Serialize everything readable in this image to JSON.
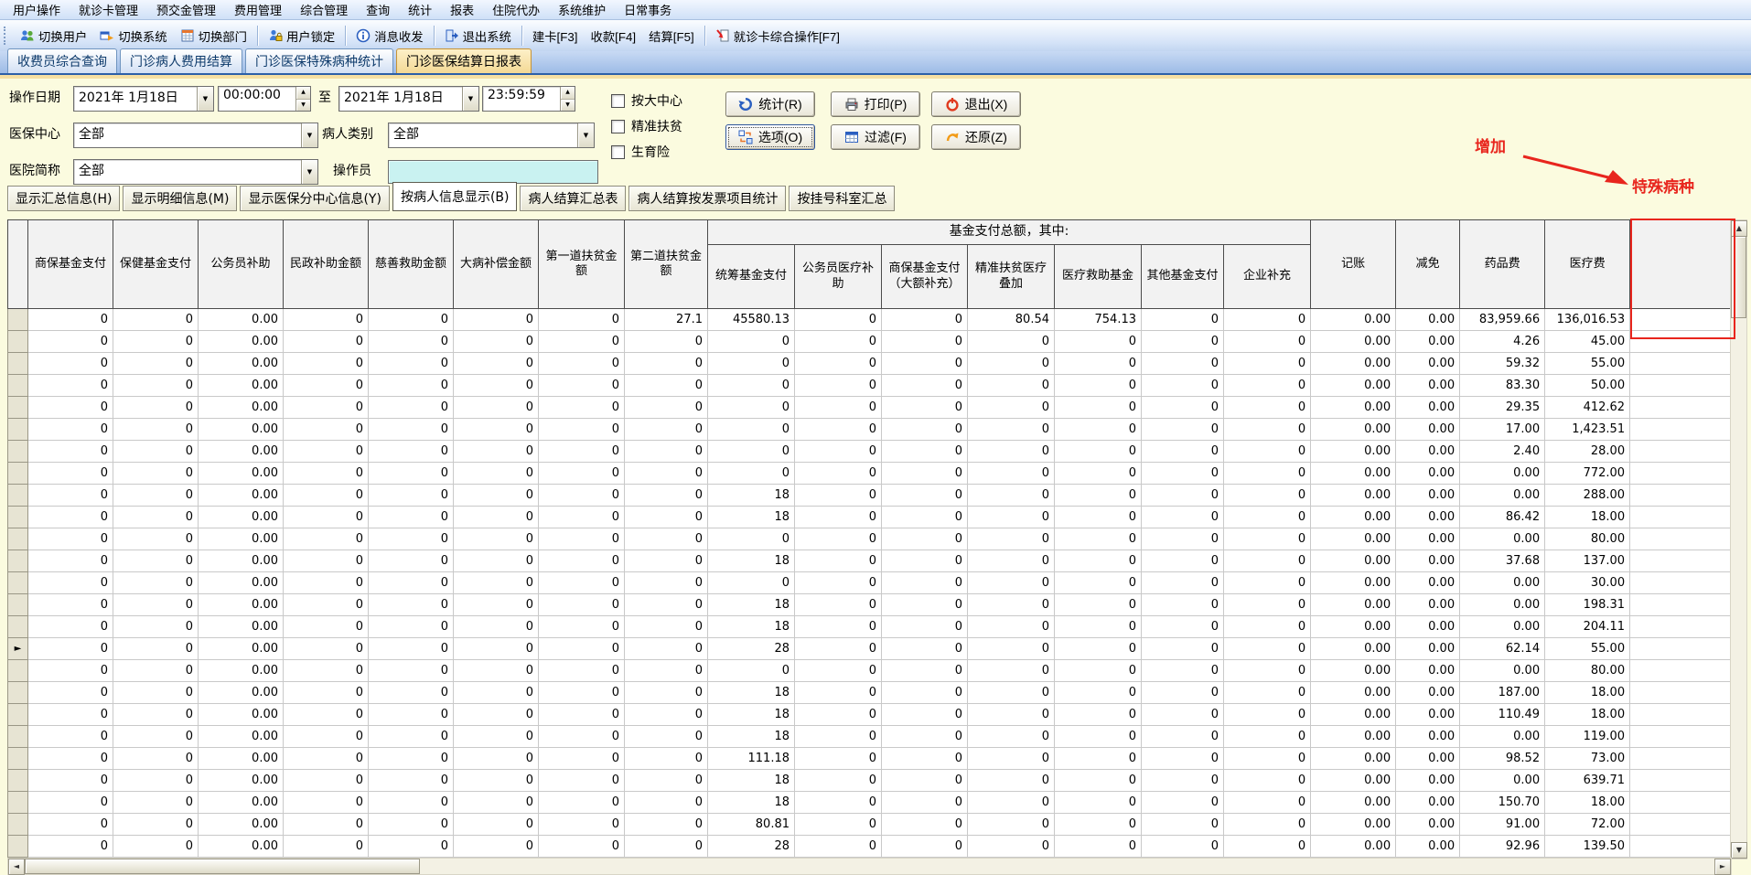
{
  "window": {
    "title": "门诊医保结算日报表"
  },
  "glyphs": {
    "dropdown": "▼",
    "spin_up": "▲",
    "spin_down": "▼",
    "scroll_up": "▲",
    "scroll_down": "▼",
    "scroll_left": "◄",
    "scroll_right": "►",
    "row_marker": "►"
  },
  "menu": {
    "items": [
      "用户操作",
      "就诊卡管理",
      "预交金管理",
      "费用管理",
      "综合管理",
      "查询",
      "统计",
      "报表",
      "住院代办",
      "系统维护",
      "日常事务"
    ]
  },
  "toolbar": {
    "items": [
      {
        "icon": "switch-user",
        "label": "切换用户",
        "sep_after": false
      },
      {
        "icon": "switch-system",
        "label": "切换系统",
        "sep_after": false
      },
      {
        "icon": "switch-dept",
        "label": "切换部门",
        "sep_after": true
      },
      {
        "icon": "user-lock",
        "label": "用户锁定",
        "sep_after": true
      },
      {
        "icon": "message",
        "label": "消息收发",
        "sep_after": true
      },
      {
        "icon": "exit-system",
        "label": "退出系统",
        "sep_after": true
      },
      {
        "icon": "",
        "label": "建卡[F3]",
        "sep_after": false
      },
      {
        "icon": "",
        "label": "收款[F4]",
        "sep_after": false
      },
      {
        "icon": "",
        "label": "结算[F5]",
        "sep_after": true
      },
      {
        "icon": "card-op",
        "label": "就诊卡综合操作[F7]",
        "sep_after": false
      }
    ]
  },
  "tabs": {
    "items": [
      "收费员综合查询",
      "门诊病人费用结算",
      "门诊医保特殊病种统计",
      "门诊医保结算日报表"
    ],
    "active_index": 3
  },
  "filters": {
    "date_label": "操作日期",
    "date_from": "2021年 1月18日",
    "time_from": "00:00:00",
    "to_label": "至",
    "date_to": "2021年 1月18日",
    "time_to": "23:59:59",
    "center_label": "医保中心",
    "center_value": "全部",
    "patient_type_label": "病人类别",
    "patient_type_value": "全部",
    "hospital_label": "医院简称",
    "hospital_value": "全部",
    "operator_label": "操作员",
    "operator_value": "",
    "checkboxes": [
      "按大中心",
      "精准扶贫",
      "生育险"
    ],
    "buttons": [
      "统计(R)",
      "打印(P)",
      "退出(X)",
      "选项(O)",
      "过滤(F)",
      "还原(Z)"
    ],
    "focused_button_index": 3
  },
  "annotation": {
    "add_label": "增加",
    "target_label": "特殊病种",
    "color": "#e8251d"
  },
  "subtabs": {
    "items": [
      "显示汇总信息(H)",
      "显示明细信息(M)",
      "显示医保分中心信息(Y)",
      "按病人信息显示(B)",
      "病人结算汇总表",
      "病人结算按发票项目统计",
      "按挂号科室汇总"
    ],
    "active_index": 3
  },
  "table": {
    "plain_columns_left": [
      "商保基金支付",
      "保健基金支付",
      "公务员补助",
      "民政补助金额",
      "慈善救助金额",
      "大病补偿金额",
      "第一道扶贫金额",
      "第二道扶贫金额"
    ],
    "group_header": "基金支付总额，其中:",
    "group_columns": [
      "统筹基金支付",
      "公务员医疗补助",
      "商保基金支付（大额补充）",
      "精准扶贫医疗叠加",
      "医疗救助基金",
      "其他基金支付",
      "企业补充"
    ],
    "plain_columns_right": [
      "记账",
      "减免",
      "药品费",
      "医疗费",
      ""
    ],
    "selected_row_index": 15,
    "rows": [
      [
        "0",
        "0",
        "0.00",
        "0",
        "0",
        "0",
        "0",
        "27.1",
        "45580.13",
        "0",
        "0",
        "80.54",
        "754.13",
        "0",
        "0",
        "0.00",
        "0.00",
        "83,959.66",
        "136,016.53",
        ""
      ],
      [
        "0",
        "0",
        "0.00",
        "0",
        "0",
        "0",
        "0",
        "0",
        "0",
        "0",
        "0",
        "0",
        "0",
        "0",
        "0",
        "0.00",
        "0.00",
        "4.26",
        "45.00",
        ""
      ],
      [
        "0",
        "0",
        "0.00",
        "0",
        "0",
        "0",
        "0",
        "0",
        "0",
        "0",
        "0",
        "0",
        "0",
        "0",
        "0",
        "0.00",
        "0.00",
        "59.32",
        "55.00",
        ""
      ],
      [
        "0",
        "0",
        "0.00",
        "0",
        "0",
        "0",
        "0",
        "0",
        "0",
        "0",
        "0",
        "0",
        "0",
        "0",
        "0",
        "0.00",
        "0.00",
        "83.30",
        "50.00",
        ""
      ],
      [
        "0",
        "0",
        "0.00",
        "0",
        "0",
        "0",
        "0",
        "0",
        "0",
        "0",
        "0",
        "0",
        "0",
        "0",
        "0",
        "0.00",
        "0.00",
        "29.35",
        "412.62",
        ""
      ],
      [
        "0",
        "0",
        "0.00",
        "0",
        "0",
        "0",
        "0",
        "0",
        "0",
        "0",
        "0",
        "0",
        "0",
        "0",
        "0",
        "0.00",
        "0.00",
        "17.00",
        "1,423.51",
        ""
      ],
      [
        "0",
        "0",
        "0.00",
        "0",
        "0",
        "0",
        "0",
        "0",
        "0",
        "0",
        "0",
        "0",
        "0",
        "0",
        "0",
        "0.00",
        "0.00",
        "2.40",
        "28.00",
        ""
      ],
      [
        "0",
        "0",
        "0.00",
        "0",
        "0",
        "0",
        "0",
        "0",
        "0",
        "0",
        "0",
        "0",
        "0",
        "0",
        "0",
        "0.00",
        "0.00",
        "0.00",
        "772.00",
        ""
      ],
      [
        "0",
        "0",
        "0.00",
        "0",
        "0",
        "0",
        "0",
        "0",
        "18",
        "0",
        "0",
        "0",
        "0",
        "0",
        "0",
        "0.00",
        "0.00",
        "0.00",
        "288.00",
        ""
      ],
      [
        "0",
        "0",
        "0.00",
        "0",
        "0",
        "0",
        "0",
        "0",
        "18",
        "0",
        "0",
        "0",
        "0",
        "0",
        "0",
        "0.00",
        "0.00",
        "86.42",
        "18.00",
        ""
      ],
      [
        "0",
        "0",
        "0.00",
        "0",
        "0",
        "0",
        "0",
        "0",
        "0",
        "0",
        "0",
        "0",
        "0",
        "0",
        "0",
        "0.00",
        "0.00",
        "0.00",
        "80.00",
        ""
      ],
      [
        "0",
        "0",
        "0.00",
        "0",
        "0",
        "0",
        "0",
        "0",
        "18",
        "0",
        "0",
        "0",
        "0",
        "0",
        "0",
        "0.00",
        "0.00",
        "37.68",
        "137.00",
        ""
      ],
      [
        "0",
        "0",
        "0.00",
        "0",
        "0",
        "0",
        "0",
        "0",
        "0",
        "0",
        "0",
        "0",
        "0",
        "0",
        "0",
        "0.00",
        "0.00",
        "0.00",
        "30.00",
        ""
      ],
      [
        "0",
        "0",
        "0.00",
        "0",
        "0",
        "0",
        "0",
        "0",
        "18",
        "0",
        "0",
        "0",
        "0",
        "0",
        "0",
        "0.00",
        "0.00",
        "0.00",
        "198.31",
        ""
      ],
      [
        "0",
        "0",
        "0.00",
        "0",
        "0",
        "0",
        "0",
        "0",
        "18",
        "0",
        "0",
        "0",
        "0",
        "0",
        "0",
        "0.00",
        "0.00",
        "0.00",
        "204.11",
        ""
      ],
      [
        "0",
        "0",
        "0.00",
        "0",
        "0",
        "0",
        "0",
        "0",
        "28",
        "0",
        "0",
        "0",
        "0",
        "0",
        "0",
        "0.00",
        "0.00",
        "62.14",
        "55.00",
        ""
      ],
      [
        "0",
        "0",
        "0.00",
        "0",
        "0",
        "0",
        "0",
        "0",
        "0",
        "0",
        "0",
        "0",
        "0",
        "0",
        "0",
        "0.00",
        "0.00",
        "0.00",
        "80.00",
        ""
      ],
      [
        "0",
        "0",
        "0.00",
        "0",
        "0",
        "0",
        "0",
        "0",
        "18",
        "0",
        "0",
        "0",
        "0",
        "0",
        "0",
        "0.00",
        "0.00",
        "187.00",
        "18.00",
        ""
      ],
      [
        "0",
        "0",
        "0.00",
        "0",
        "0",
        "0",
        "0",
        "0",
        "18",
        "0",
        "0",
        "0",
        "0",
        "0",
        "0",
        "0.00",
        "0.00",
        "110.49",
        "18.00",
        ""
      ],
      [
        "0",
        "0",
        "0.00",
        "0",
        "0",
        "0",
        "0",
        "0",
        "18",
        "0",
        "0",
        "0",
        "0",
        "0",
        "0",
        "0.00",
        "0.00",
        "0.00",
        "119.00",
        ""
      ],
      [
        "0",
        "0",
        "0.00",
        "0",
        "0",
        "0",
        "0",
        "0",
        "111.18",
        "0",
        "0",
        "0",
        "0",
        "0",
        "0",
        "0.00",
        "0.00",
        "98.52",
        "73.00",
        ""
      ],
      [
        "0",
        "0",
        "0.00",
        "0",
        "0",
        "0",
        "0",
        "0",
        "18",
        "0",
        "0",
        "0",
        "0",
        "0",
        "0",
        "0.00",
        "0.00",
        "0.00",
        "639.71",
        ""
      ],
      [
        "0",
        "0",
        "0.00",
        "0",
        "0",
        "0",
        "0",
        "0",
        "18",
        "0",
        "0",
        "0",
        "0",
        "0",
        "0",
        "0.00",
        "0.00",
        "150.70",
        "18.00",
        ""
      ],
      [
        "0",
        "0",
        "0.00",
        "0",
        "0",
        "0",
        "0",
        "0",
        "80.81",
        "0",
        "0",
        "0",
        "0",
        "0",
        "0",
        "0.00",
        "0.00",
        "91.00",
        "72.00",
        ""
      ],
      [
        "0",
        "0",
        "0.00",
        "0",
        "0",
        "0",
        "0",
        "0",
        "28",
        "0",
        "0",
        "0",
        "0",
        "0",
        "0",
        "0.00",
        "0.00",
        "92.96",
        "139.50",
        ""
      ]
    ]
  }
}
